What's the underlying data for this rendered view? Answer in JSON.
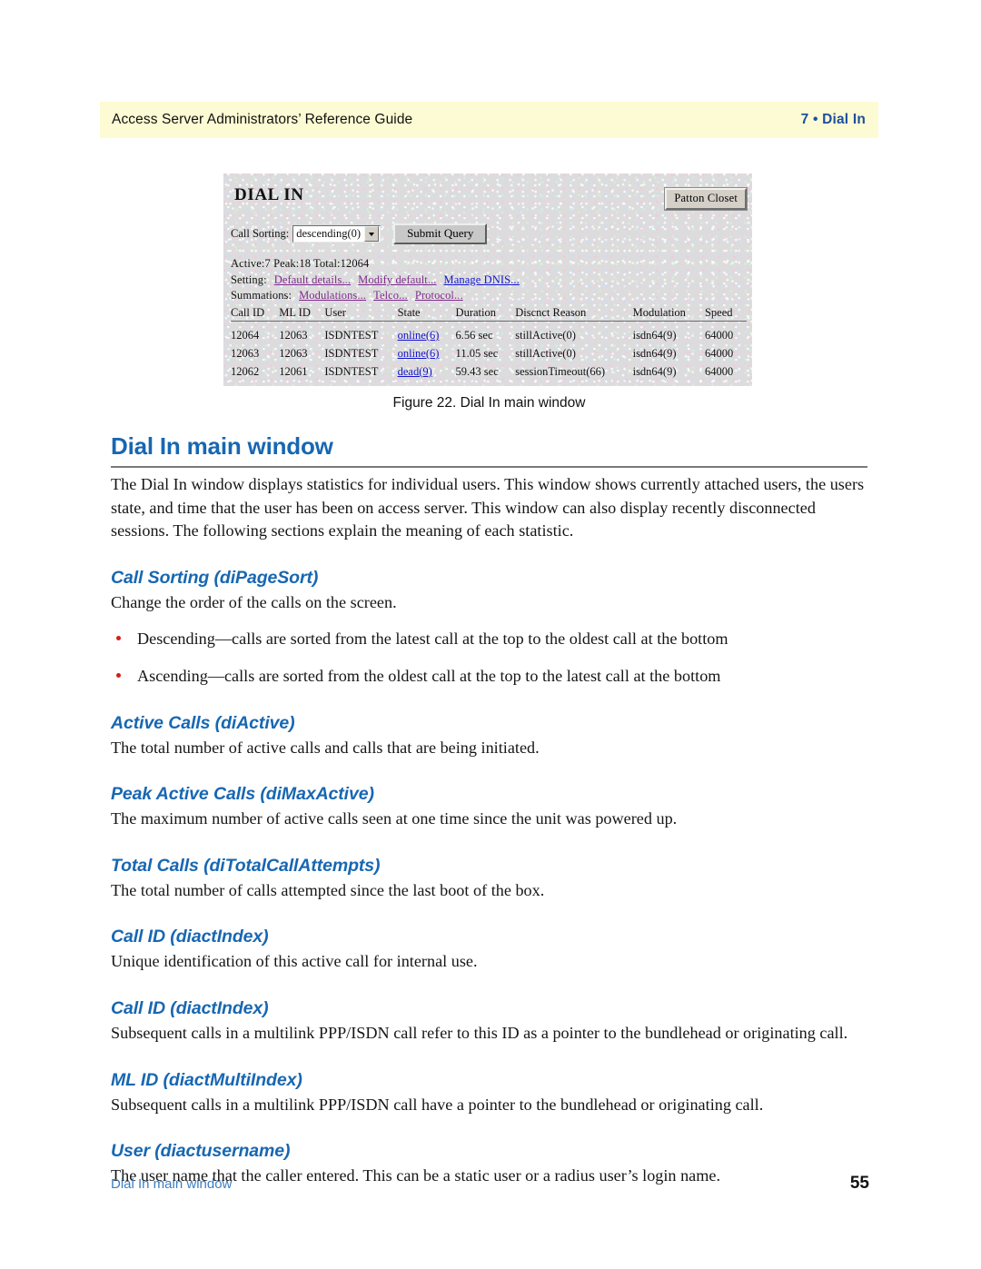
{
  "header": {
    "left": "Access Server Administrators’ Reference Guide",
    "right": "7 • Dial In",
    "band_color": "#fdfbd3",
    "accent_color": "#1d4f9e"
  },
  "figure": {
    "caption": "Figure 22. Dial In main window",
    "screenshot": {
      "title": "DIAL IN",
      "closet_button": "Patton Closet",
      "sort_label": "Call Sorting:",
      "sort_value": "descending(0)",
      "submit_button": "Submit Query",
      "stats_line": "Active:7 Peak:18 Total:12064",
      "setting_label": "Setting:",
      "setting_links": [
        {
          "text": "Default details...",
          "state": "visited"
        },
        {
          "text": "Modify default...",
          "state": "visited"
        },
        {
          "text": "Manage DNIS...",
          "state": "unvisited"
        }
      ],
      "summations_label": "Summations:",
      "summations_links": [
        {
          "text": "Modulations...",
          "state": "visited"
        },
        {
          "text": "Telco...",
          "state": "visited"
        },
        {
          "text": "Protocol...",
          "state": "visited"
        }
      ],
      "columns": [
        "Call ID",
        "ML ID",
        "User",
        "State",
        "Duration",
        "Discnct Reason",
        "Modulation",
        "Speed"
      ],
      "rows": [
        {
          "call_id": "12064",
          "ml_id": "12063",
          "user": "ISDNTEST",
          "state": "online(6)",
          "state_kind": "online",
          "duration": "6.56 sec",
          "discnct_reason": "stillActive(0)",
          "modulation": "isdn64(9)",
          "speed": "64000"
        },
        {
          "call_id": "12063",
          "ml_id": "12063",
          "user": "ISDNTEST",
          "state": "online(6)",
          "state_kind": "online",
          "duration": "11.05 sec",
          "discnct_reason": "stillActive(0)",
          "modulation": "isdn64(9)",
          "speed": "64000"
        },
        {
          "call_id": "12062",
          "ml_id": "12061",
          "user": "ISDNTEST",
          "state": "dead(9)",
          "state_kind": "dead",
          "duration": "59.43 sec",
          "discnct_reason": "sessionTimeout(66)",
          "modulation": "isdn64(9)",
          "speed": "64000"
        }
      ]
    }
  },
  "section": {
    "title": "Dial In main window",
    "intro": "The Dial In window displays statistics for individual users. This window shows currently attached users, the users state, and time that the user has been on access server. This window can also display recently disconnected sessions. The following sections explain the meaning of each statistic."
  },
  "subsections": [
    {
      "heading": "Call Sorting (diPageSort)",
      "body": "Change the order of the calls on the screen.",
      "bullets": [
        "Descending—calls are sorted from the latest call at the top to the oldest call at the bottom",
        "Ascending—calls are sorted from the oldest call at the top to the latest call at the bottom"
      ]
    },
    {
      "heading": "Active Calls (diActive)",
      "body": "The total number of active calls and calls that are being initiated."
    },
    {
      "heading": "Peak Active Calls (diMaxActive)",
      "body": "The maximum number of active calls seen at one time since the unit was powered up."
    },
    {
      "heading": "Total Calls (diTotalCallAttempts)",
      "body": "The total number of calls attempted since the last boot of the box."
    },
    {
      "heading": "Call ID (diactIndex)",
      "body": "Unique identification of this active call for internal use."
    },
    {
      "heading": "Call ID (diactIndex)",
      "body": "Subsequent calls in a multilink PPP/ISDN call refer to this ID as a pointer to the bundlehead or originating call."
    },
    {
      "heading": "ML ID (diactMultiIndex)",
      "body": "Subsequent calls in a multilink PPP/ISDN call have a pointer to the bundlehead or originating call."
    },
    {
      "heading": "User (diactusername)",
      "body": "The user name that the caller entered. This can be a static user or a radius user’s login name."
    }
  ],
  "footer": {
    "left": "Dial In main window",
    "page_number": "55"
  }
}
